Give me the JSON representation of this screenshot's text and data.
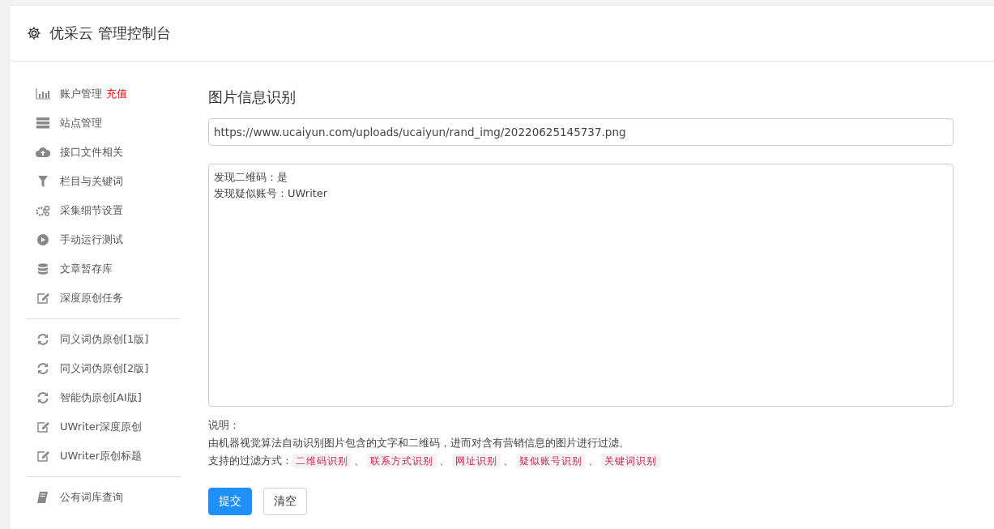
{
  "header": {
    "title": "优采云 管理控制台"
  },
  "sidebar": {
    "groups": [
      {
        "items": [
          {
            "label": "账户管理",
            "badge": "充值"
          },
          {
            "label": "站点管理"
          },
          {
            "label": "接口文件相关"
          },
          {
            "label": "栏目与关键词"
          },
          {
            "label": "采集细节设置"
          },
          {
            "label": "手动运行测试"
          },
          {
            "label": "文章暂存库"
          },
          {
            "label": "深度原创任务"
          }
        ]
      },
      {
        "items": [
          {
            "label": "同义词伪原创[1版]"
          },
          {
            "label": "同义词伪原创[2版]"
          },
          {
            "label": "智能伪原创[AI版]"
          },
          {
            "label": "UWriter深度原创"
          },
          {
            "label": "UWriter原创标题"
          }
        ]
      },
      {
        "items": [
          {
            "label": "公有词库查询"
          }
        ]
      }
    ]
  },
  "main": {
    "title": "图片信息识别",
    "url_field": {
      "value": "https://www.ucaiyun.com/uploads/ucaiyun/rand_img/20220625145737.png"
    },
    "result_area": {
      "lines": [
        "发现二维码：是",
        "发现疑似账号：UWriter"
      ]
    },
    "notes_title": "说明：",
    "notes_text": "由机器视觉算法自动识别图片包含的文字和二维码，进而对含有营销信息的图片进行过滤。",
    "filters_label": "支持的过滤方式：",
    "filter_tags": [
      "二维码识别",
      "联系方式识别",
      "网址识别",
      "疑似账号识别",
      "关键词识别"
    ],
    "separator": "、",
    "buttons": [
      {
        "label": "提交",
        "kind": "primary"
      },
      {
        "label": "清空",
        "kind": "default"
      }
    ]
  }
}
